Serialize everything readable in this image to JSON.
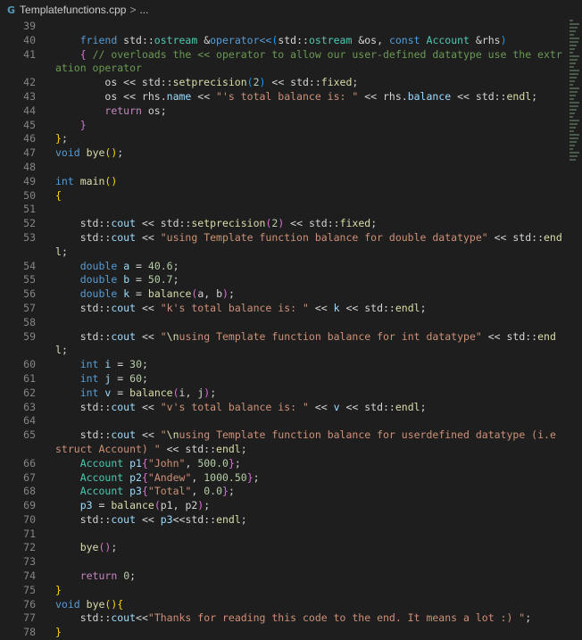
{
  "breadcrumb": {
    "file": "Templatefunctions.cpp",
    "separator": ">",
    "more": "..."
  },
  "lines": [
    {
      "n": "39",
      "t": []
    },
    {
      "n": "40",
      "t": [
        [
          "    ",
          "pl"
        ],
        [
          "friend",
          "kw"
        ],
        [
          " std::",
          "pl"
        ],
        [
          "ostream",
          "ty"
        ],
        [
          " &",
          "pl"
        ],
        [
          "operator<<",
          "kw"
        ],
        [
          "(",
          "br3"
        ],
        [
          "std::",
          "pl"
        ],
        [
          "ostream",
          "ty"
        ],
        [
          " &os, ",
          "pl"
        ],
        [
          "const",
          "kw"
        ],
        [
          " ",
          "pl"
        ],
        [
          "Account",
          "ty"
        ],
        [
          " &rhs",
          "pl"
        ],
        [
          ")",
          "br3"
        ]
      ]
    },
    {
      "n": "41",
      "t": [
        [
          "    ",
          "pl"
        ],
        [
          "{",
          "br2"
        ],
        [
          " // overloads the << operator to allow our user-defined datatype use the extration operator",
          "cm"
        ]
      ]
    },
    {
      "n": "42",
      "t": [
        [
          "        os << std::",
          "pl"
        ],
        [
          "setprecision",
          "fn"
        ],
        [
          "(",
          "br3"
        ],
        [
          "2",
          "num"
        ],
        [
          ")",
          "br3"
        ],
        [
          " << std::",
          "pl"
        ],
        [
          "fixed",
          "fn"
        ],
        [
          ";",
          "pl"
        ]
      ]
    },
    {
      "n": "43",
      "t": [
        [
          "        os << rhs.",
          "pl"
        ],
        [
          "name",
          "var"
        ],
        [
          " << ",
          "pl"
        ],
        [
          "\"'s total balance is: \"",
          "str"
        ],
        [
          " << rhs.",
          "pl"
        ],
        [
          "balance",
          "var"
        ],
        [
          " << std::",
          "pl"
        ],
        [
          "endl",
          "fn"
        ],
        [
          ";",
          "pl"
        ]
      ]
    },
    {
      "n": "44",
      "t": [
        [
          "        ",
          "pl"
        ],
        [
          "return",
          "kc"
        ],
        [
          " os;",
          "pl"
        ]
      ]
    },
    {
      "n": "45",
      "t": [
        [
          "    ",
          "pl"
        ],
        [
          "}",
          "br2"
        ]
      ]
    },
    {
      "n": "46",
      "t": [
        [
          "}",
          "br1"
        ],
        [
          ";",
          "pl"
        ]
      ]
    },
    {
      "n": "47",
      "t": [
        [
          "void",
          "kw"
        ],
        [
          " ",
          "pl"
        ],
        [
          "bye",
          "fn"
        ],
        [
          "()",
          "br1"
        ],
        [
          ";",
          "pl"
        ]
      ]
    },
    {
      "n": "48",
      "t": []
    },
    {
      "n": "49",
      "t": [
        [
          "int",
          "kw"
        ],
        [
          " ",
          "pl"
        ],
        [
          "main",
          "fn"
        ],
        [
          "()",
          "br1"
        ]
      ]
    },
    {
      "n": "50",
      "t": [
        [
          "{",
          "br1"
        ]
      ]
    },
    {
      "n": "51",
      "t": []
    },
    {
      "n": "52",
      "t": [
        [
          "    std::",
          "pl"
        ],
        [
          "cout",
          "var"
        ],
        [
          " << std::",
          "pl"
        ],
        [
          "setprecision",
          "fn"
        ],
        [
          "(",
          "br2"
        ],
        [
          "2",
          "num"
        ],
        [
          ")",
          "br2"
        ],
        [
          " << std::",
          "pl"
        ],
        [
          "fixed",
          "fn"
        ],
        [
          ";",
          "pl"
        ]
      ]
    },
    {
      "n": "53",
      "t": [
        [
          "    std::",
          "pl"
        ],
        [
          "cout",
          "var"
        ],
        [
          " << ",
          "pl"
        ],
        [
          "\"using Template function balance for double datatype\"",
          "str"
        ],
        [
          " << std::",
          "pl"
        ],
        [
          "endl",
          "fn"
        ],
        [
          ";",
          "pl"
        ]
      ]
    },
    {
      "n": "54",
      "t": [
        [
          "    ",
          "pl"
        ],
        [
          "double",
          "kw"
        ],
        [
          " ",
          "pl"
        ],
        [
          "a",
          "var"
        ],
        [
          " = ",
          "pl"
        ],
        [
          "40.6",
          "num"
        ],
        [
          ";",
          "pl"
        ]
      ]
    },
    {
      "n": "55",
      "t": [
        [
          "    ",
          "pl"
        ],
        [
          "double",
          "kw"
        ],
        [
          " ",
          "pl"
        ],
        [
          "b",
          "var"
        ],
        [
          " = ",
          "pl"
        ],
        [
          "50.7",
          "num"
        ],
        [
          ";",
          "pl"
        ]
      ]
    },
    {
      "n": "56",
      "t": [
        [
          "    ",
          "pl"
        ],
        [
          "double",
          "kw"
        ],
        [
          " ",
          "pl"
        ],
        [
          "k",
          "var"
        ],
        [
          " = ",
          "pl"
        ],
        [
          "balance",
          "fn"
        ],
        [
          "(",
          "br2"
        ],
        [
          "a, b",
          "pl"
        ],
        [
          ")",
          "br2"
        ],
        [
          ";",
          "pl"
        ]
      ]
    },
    {
      "n": "57",
      "t": [
        [
          "    std::",
          "pl"
        ],
        [
          "cout",
          "var"
        ],
        [
          " << ",
          "pl"
        ],
        [
          "\"k's total balance is: \"",
          "str"
        ],
        [
          " << ",
          "pl"
        ],
        [
          "k",
          "var"
        ],
        [
          " << std::",
          "pl"
        ],
        [
          "endl",
          "fn"
        ],
        [
          ";",
          "pl"
        ]
      ]
    },
    {
      "n": "58",
      "t": []
    },
    {
      "n": "59",
      "t": [
        [
          "    std::",
          "pl"
        ],
        [
          "cout",
          "var"
        ],
        [
          " << ",
          "pl"
        ],
        [
          "\"",
          "str"
        ],
        [
          "\\n",
          "fn"
        ],
        [
          "using Template function balance for int datatype\"",
          "str"
        ],
        [
          " << std::",
          "pl"
        ],
        [
          "endl",
          "fn"
        ],
        [
          ";",
          "pl"
        ]
      ]
    },
    {
      "n": "60",
      "t": [
        [
          "    ",
          "pl"
        ],
        [
          "int",
          "kw"
        ],
        [
          " ",
          "pl"
        ],
        [
          "i",
          "var"
        ],
        [
          " = ",
          "pl"
        ],
        [
          "30",
          "num"
        ],
        [
          ";",
          "pl"
        ]
      ]
    },
    {
      "n": "61",
      "t": [
        [
          "    ",
          "pl"
        ],
        [
          "int",
          "kw"
        ],
        [
          " ",
          "pl"
        ],
        [
          "j",
          "var"
        ],
        [
          " = ",
          "pl"
        ],
        [
          "60",
          "num"
        ],
        [
          ";",
          "pl"
        ]
      ]
    },
    {
      "n": "62",
      "t": [
        [
          "    ",
          "pl"
        ],
        [
          "int",
          "kw"
        ],
        [
          " ",
          "pl"
        ],
        [
          "v",
          "var"
        ],
        [
          " = ",
          "pl"
        ],
        [
          "balance",
          "fn"
        ],
        [
          "(",
          "br2"
        ],
        [
          "i, j",
          "pl"
        ],
        [
          ")",
          "br2"
        ],
        [
          ";",
          "pl"
        ]
      ]
    },
    {
      "n": "63",
      "t": [
        [
          "    std::",
          "pl"
        ],
        [
          "cout",
          "var"
        ],
        [
          " << ",
          "pl"
        ],
        [
          "\"v's total balance is: \"",
          "str"
        ],
        [
          " << ",
          "pl"
        ],
        [
          "v",
          "var"
        ],
        [
          " << std::",
          "pl"
        ],
        [
          "endl",
          "fn"
        ],
        [
          ";",
          "pl"
        ]
      ]
    },
    {
      "n": "64",
      "t": []
    },
    {
      "n": "65",
      "t": [
        [
          "    std::",
          "pl"
        ],
        [
          "cout",
          "var"
        ],
        [
          " << ",
          "pl"
        ],
        [
          "\"",
          "str"
        ],
        [
          "\\n",
          "fn"
        ],
        [
          "using Template function balance for userdefined datatype (i.e struct Account) \"",
          "str"
        ],
        [
          " << std::",
          "pl"
        ],
        [
          "endl",
          "fn"
        ],
        [
          ";",
          "pl"
        ]
      ]
    },
    {
      "n": "66",
      "t": [
        [
          "    ",
          "pl"
        ],
        [
          "Account",
          "ty"
        ],
        [
          " ",
          "pl"
        ],
        [
          "p1",
          "var"
        ],
        [
          "{",
          "br2"
        ],
        [
          "\"John\"",
          "str"
        ],
        [
          ", ",
          "pl"
        ],
        [
          "500.0",
          "num"
        ],
        [
          "}",
          "br2"
        ],
        [
          ";",
          "pl"
        ]
      ]
    },
    {
      "n": "67",
      "t": [
        [
          "    ",
          "pl"
        ],
        [
          "Account",
          "ty"
        ],
        [
          " ",
          "pl"
        ],
        [
          "p2",
          "var"
        ],
        [
          "{",
          "br2"
        ],
        [
          "\"Andew\"",
          "str"
        ],
        [
          ", ",
          "pl"
        ],
        [
          "1000.50",
          "num"
        ],
        [
          "}",
          "br2"
        ],
        [
          ";",
          "pl"
        ]
      ]
    },
    {
      "n": "68",
      "t": [
        [
          "    ",
          "pl"
        ],
        [
          "Account",
          "ty"
        ],
        [
          " ",
          "pl"
        ],
        [
          "p3",
          "var"
        ],
        [
          "{",
          "br2"
        ],
        [
          "\"Total\"",
          "str"
        ],
        [
          ", ",
          "pl"
        ],
        [
          "0.0",
          "num"
        ],
        [
          "}",
          "br2"
        ],
        [
          ";",
          "pl"
        ]
      ]
    },
    {
      "n": "69",
      "t": [
        [
          "    ",
          "pl"
        ],
        [
          "p3",
          "var"
        ],
        [
          " = ",
          "pl"
        ],
        [
          "balance",
          "fn"
        ],
        [
          "(",
          "br2"
        ],
        [
          "p1, p2",
          "pl"
        ],
        [
          ")",
          "br2"
        ],
        [
          ";",
          "pl"
        ]
      ]
    },
    {
      "n": "70",
      "t": [
        [
          "    std::",
          "pl"
        ],
        [
          "cout",
          "var"
        ],
        [
          " << ",
          "pl"
        ],
        [
          "p3",
          "var"
        ],
        [
          "<<std::",
          "pl"
        ],
        [
          "endl",
          "fn"
        ],
        [
          ";",
          "pl"
        ]
      ]
    },
    {
      "n": "71",
      "t": []
    },
    {
      "n": "72",
      "t": [
        [
          "    ",
          "pl"
        ],
        [
          "bye",
          "fn"
        ],
        [
          "()",
          "br2"
        ],
        [
          ";",
          "pl"
        ]
      ]
    },
    {
      "n": "73",
      "t": []
    },
    {
      "n": "74",
      "t": [
        [
          "    ",
          "pl"
        ],
        [
          "return",
          "kc"
        ],
        [
          " ",
          "pl"
        ],
        [
          "0",
          "num"
        ],
        [
          ";",
          "pl"
        ]
      ]
    },
    {
      "n": "75",
      "t": [
        [
          "}",
          "br1"
        ]
      ]
    },
    {
      "n": "76",
      "t": [
        [
          "void",
          "kw"
        ],
        [
          " ",
          "pl"
        ],
        [
          "bye",
          "fn"
        ],
        [
          "()",
          "br1"
        ],
        [
          "{",
          "br1"
        ]
      ]
    },
    {
      "n": "77",
      "t": [
        [
          "    std::",
          "pl"
        ],
        [
          "cout",
          "var"
        ],
        [
          "<<",
          "pl"
        ],
        [
          "\"Thanks for reading this code to the end. It means a lot :) \"",
          "str"
        ],
        [
          ";",
          "pl"
        ]
      ]
    },
    {
      "n": "78",
      "t": [
        [
          "}",
          "br1"
        ]
      ]
    }
  ]
}
